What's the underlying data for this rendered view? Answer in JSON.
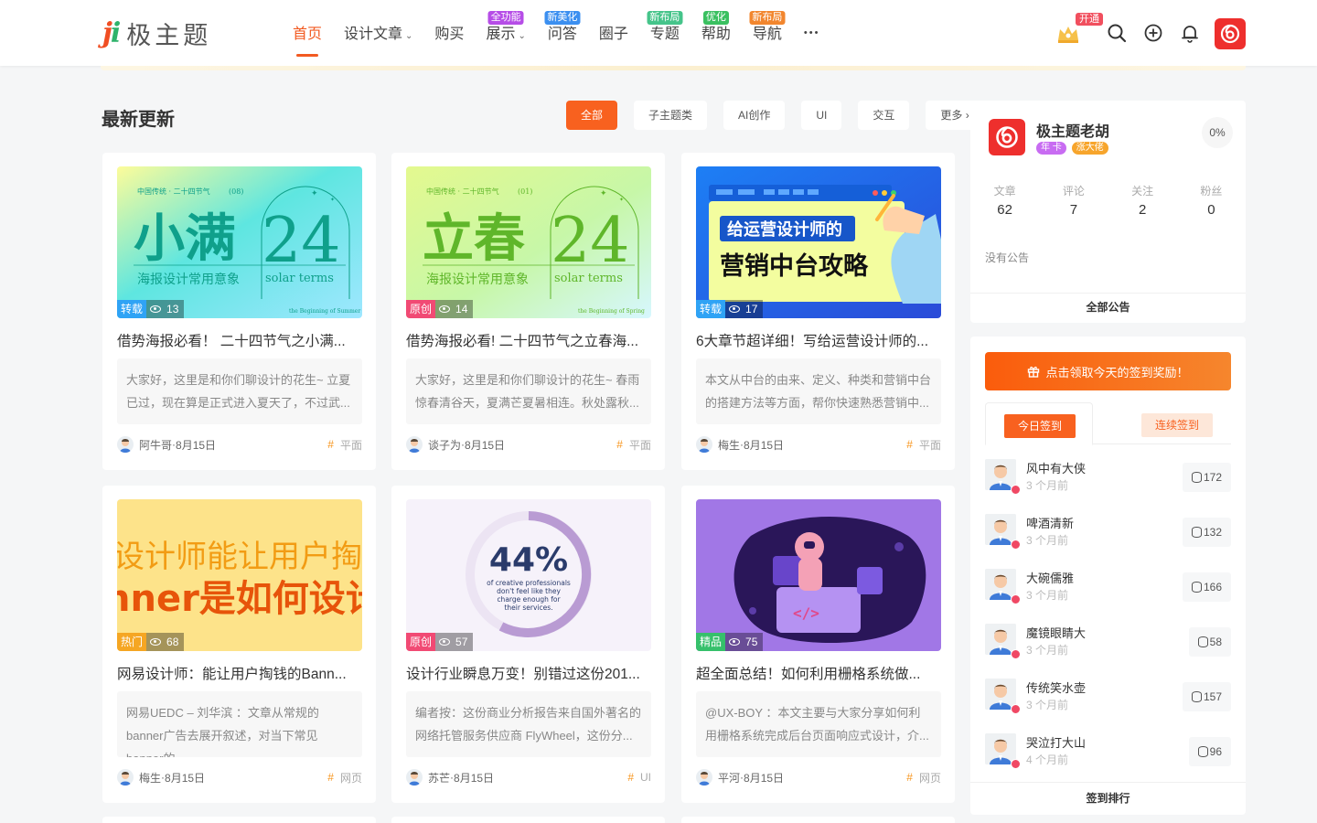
{
  "header": {
    "logo_mark": "ji",
    "logo_text": "极主题",
    "nav": [
      {
        "label": "首页",
        "active": true
      },
      {
        "label": "设计文章",
        "dropdown": true
      },
      {
        "label": "购买"
      },
      {
        "label": "展示",
        "dropdown": true,
        "badge": "全功能",
        "badge_color": "#b64de7"
      },
      {
        "label": "问答",
        "badge": "新美化",
        "badge_color": "#3b8ff0"
      },
      {
        "label": "圈子"
      },
      {
        "label": "专题",
        "badge": "新布局",
        "badge_color": "#45c48a"
      },
      {
        "label": "帮助",
        "badge": "优化",
        "badge_color": "#3ac060"
      },
      {
        "label": "导航",
        "badge": "新布局",
        "badge_color": "#f2862e"
      }
    ],
    "more_icon": "more-dots-icon",
    "vip_badge": "开通",
    "icons": [
      "vip-crown-icon",
      "search-icon",
      "add-circle-icon",
      "bell-icon"
    ]
  },
  "section": {
    "title": "最新更新",
    "tabs": [
      {
        "label": "全部",
        "active": true
      },
      {
        "label": "子主题类"
      },
      {
        "label": "AI创作"
      },
      {
        "label": "UI"
      },
      {
        "label": "交互"
      },
      {
        "label": "更多 ›"
      }
    ]
  },
  "posts": [
    {
      "tag": "转载",
      "tag_color": "#2fa3f5",
      "views": "13",
      "title": "借势海报必看！ 二十四节气之小满...",
      "excerpt": "大家好，这里是和你们聊设计的花生~ 立夏已过，现在算是正式进入夏天了，不过武...",
      "author": "阿牛哥",
      "date": "8月15日",
      "category": "平面",
      "thumb": {
        "kind": "solar",
        "big": "小满",
        "num": "24",
        "top_left": "中国传统 · 二十四节气",
        "top_right": "(08)",
        "sub_left": "海报设计常用意象",
        "sub_right": "solar terms",
        "bottom_right": "the Beginning of Summer"
      }
    },
    {
      "tag": "原创",
      "tag_color": "#f14a74",
      "views": "14",
      "title": "借势海报必看! 二十四节气之立春海...",
      "excerpt": "大家好，这里是和你们聊设计的花生~ 春雨惊春清谷天，夏满芒夏暑相连。秋处露秋...",
      "author": "谈子为",
      "date": "8月15日",
      "category": "平面",
      "thumb": {
        "kind": "solar",
        "big": "立春",
        "num": "24",
        "top_left": "中国传统 · 二十四节气",
        "top_right": "(01)",
        "sub_left": "海报设计常用意象",
        "sub_right": "solar terms",
        "bottom_right": "the Beginning of Spring"
      }
    },
    {
      "tag": "转载",
      "tag_color": "#2fa3f5",
      "views": "17",
      "title": "6大章节超详细！写给运营设计师的...",
      "excerpt": "本文从中台的由来、定义、种类和营销中台的搭建方法等方面，帮你快速熟悉营销中...",
      "author": "梅生",
      "date": "8月15日",
      "category": "平面",
      "thumb": {
        "kind": "ops",
        "line1": "给运营设计师的",
        "line2": "营销中台攻略"
      }
    },
    {
      "tag": "热门",
      "tag_color": "#f5a623",
      "views": "68",
      "title": "网易设计师：能让用户掏钱的Bann...",
      "excerpt": "网易UEDC – 刘华滨 ：文章从常规的banner广告去展开叙述，对当下常见banner的...",
      "author": "梅生",
      "date": "8月15日",
      "category": "网页",
      "thumb": {
        "kind": "banner",
        "line1": "设计师能让用户掏钱",
        "line2": "nner是如何设计"
      }
    },
    {
      "tag": "原创",
      "tag_color": "#f14a74",
      "views": "57",
      "title": "设计行业瞬息万变！别错过这份201...",
      "excerpt": "编者按：这份商业分析报告来自国外著名的网络托管服务供应商 FlyWheel，这份分...",
      "author": "苏芒",
      "date": "8月15日",
      "category": "UI",
      "thumb": {
        "kind": "pct",
        "big": "44%",
        "small1": "of creative professionals",
        "small2": "don't feel like they",
        "small3": "charge enough for",
        "small4": "their services."
      }
    },
    {
      "tag": "精品",
      "tag_color": "#36c06b",
      "views": "75",
      "title": "超全面总结！如何利用栅格系统做...",
      "excerpt": "@UX-BOY ：本文主要与大家分享如何利用栅格系统完成后台页面响应式设计，介...",
      "author": "平河",
      "date": "8月15日",
      "category": "网页",
      "thumb": {
        "kind": "astro"
      }
    }
  ],
  "profile": {
    "name": "极主题老胡",
    "badge1": "年 卡",
    "badge2": "涨大佬",
    "percent": "0%",
    "stats": [
      {
        "label": "文章",
        "value": "62"
      },
      {
        "label": "评论",
        "value": "7"
      },
      {
        "label": "关注",
        "value": "2"
      },
      {
        "label": "粉丝",
        "value": "0"
      }
    ],
    "notice": "没有公告",
    "all_notice": "全部公告"
  },
  "checkin": {
    "button": "点击领取今天的签到奖励！",
    "tab_today": "今日签到",
    "tab_streak": "连续签到",
    "list": [
      {
        "name": "风中有大侠",
        "time": "3 个月前",
        "score": "172"
      },
      {
        "name": "啤酒清新",
        "time": "3 个月前",
        "score": "132"
      },
      {
        "name": "大碗儒雅",
        "time": "3 个月前",
        "score": "166"
      },
      {
        "name": "魔镜眼睛大",
        "time": "3 个月前",
        "score": "58"
      },
      {
        "name": "传统笑水壶",
        "time": "3 个月前",
        "score": "157"
      },
      {
        "name": "哭泣打大山",
        "time": "4 个月前",
        "score": "96"
      }
    ],
    "footer": "签到排行"
  }
}
